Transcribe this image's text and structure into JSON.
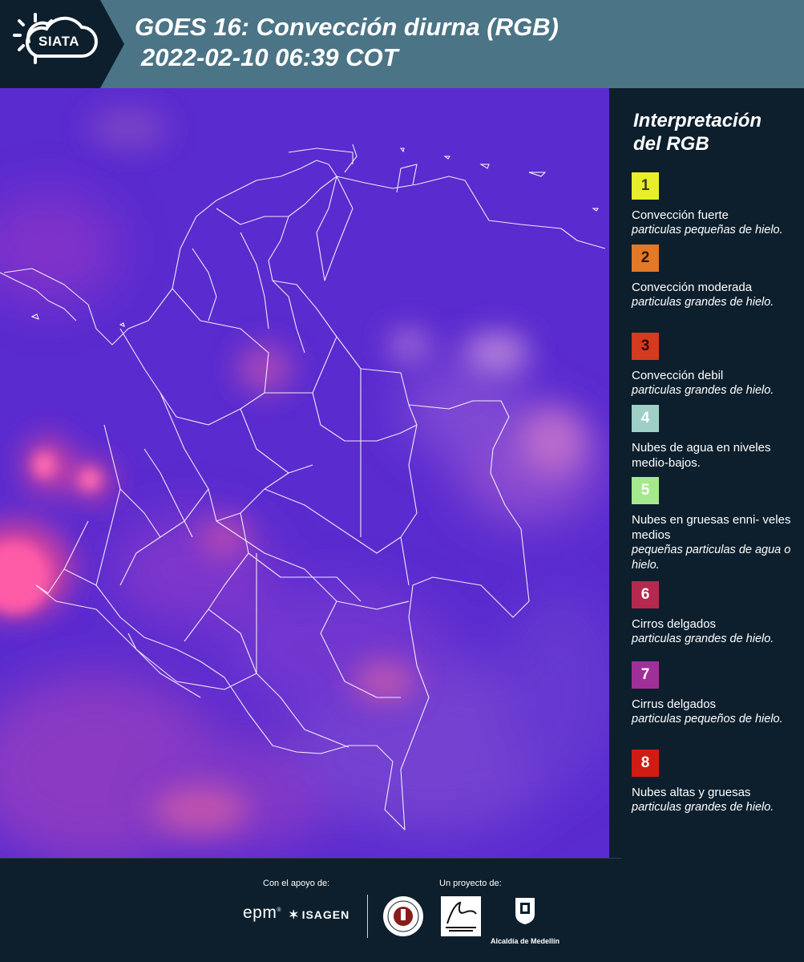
{
  "header": {
    "logo_text": "SIATA",
    "title_line1": "GOES 16: Convección diurna (RGB)",
    "title_line2": "2022-02-10 06:39 COT"
  },
  "legend": {
    "title": "Interpretación del RGB",
    "items": [
      {
        "number": "1",
        "color": "#e8ee2a",
        "text_color": "#3a3a1a",
        "name": "Convección fuerte",
        "desc": "particulas pequeñas de hielo."
      },
      {
        "number": "2",
        "color": "#e37826",
        "text_color": "#2a1a0a",
        "name": "Convección moderada",
        "desc": "particulas grandes de hielo."
      },
      {
        "number": "3",
        "color": "#d63a1f",
        "text_color": "#2a0a05",
        "name": "Convección debil",
        "desc": "particulas grandes de hielo."
      },
      {
        "number": "4",
        "color": "#9fcfc7",
        "text_color": "#ffffff",
        "name": "Nubes de agua en niveles medio-bajos.",
        "desc": ""
      },
      {
        "number": "5",
        "color": "#a6e88e",
        "text_color": "#ffffff",
        "name": "Nubes en gruesas enni- veles medios",
        "desc": "pequeñas particulas de agua o hielo."
      },
      {
        "number": "6",
        "color": "#b5294f",
        "text_color": "#ffffff",
        "name": "Cirros delgados",
        "desc": "particulas grandes de hielo."
      },
      {
        "number": "7",
        "color": "#a03099",
        "text_color": "#ffffff",
        "name": "Cirrus delgados",
        "desc": "particulas pequeños de hielo."
      },
      {
        "number": "8",
        "color": "#d01c14",
        "text_color": "#ffffff",
        "name": "Nubes altas y gruesas",
        "desc": "particulas grandes de hielo."
      }
    ]
  },
  "footer": {
    "support_label": "Con el apoyo de:",
    "project_label": "Un proyecto de:",
    "epm": "epm",
    "isagen": "ISAGEN",
    "alcaldia": "Alcaldía de Medellín"
  }
}
